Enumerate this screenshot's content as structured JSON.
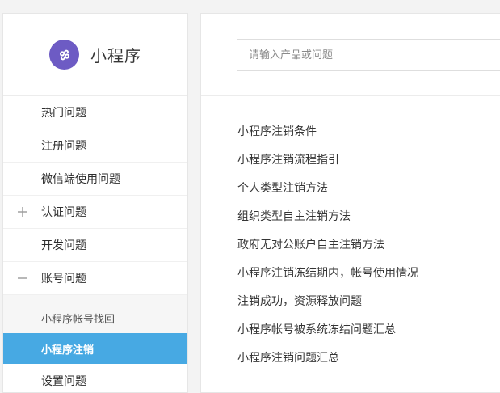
{
  "colors": {
    "accent": "#47a9e3",
    "logo": "#6d5bc4",
    "page_bg": "#f3f3f3"
  },
  "brand": {
    "title": "小程序",
    "logo_icon": "mini-program-logo-icon"
  },
  "search": {
    "placeholder": "请输入产品或问题",
    "value": ""
  },
  "sidebar": {
    "items": [
      {
        "label": "热门问题"
      },
      {
        "label": "注册问题"
      },
      {
        "label": "微信端使用问题"
      },
      {
        "label": "认证问题",
        "toggle": "plus-icon"
      },
      {
        "label": "开发问题"
      },
      {
        "label": "账号问题",
        "toggle": "minus-icon"
      }
    ],
    "sub_items": [
      {
        "label": "小程序帐号找回",
        "active": false
      },
      {
        "label": "小程序注销",
        "active": true
      }
    ],
    "cut_item": {
      "label": "设置问题"
    }
  },
  "articles": [
    "小程序注销条件",
    "小程序注销流程指引",
    "个人类型注销方法",
    "组织类型自主注销方法",
    "政府无对公账户自主注销方法",
    "小程序注销冻结期内，帐号使用情况",
    "注销成功，资源释放问题",
    "小程序帐号被系统冻结问题汇总",
    "小程序注销问题汇总"
  ]
}
